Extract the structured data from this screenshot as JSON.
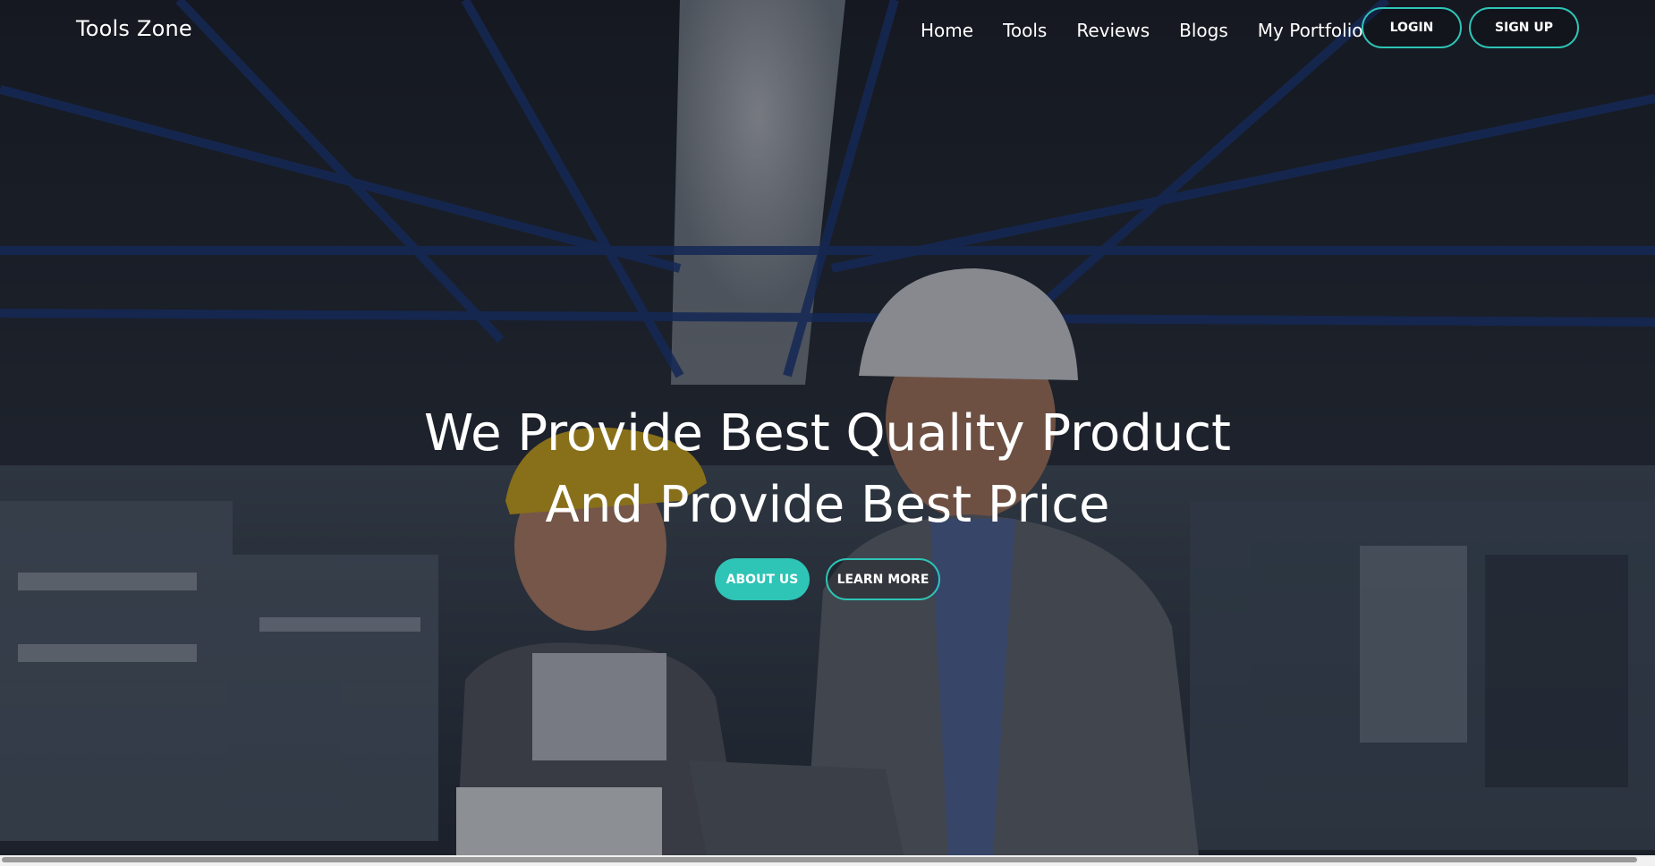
{
  "brand": {
    "name": "Tools Zone"
  },
  "nav": {
    "items": [
      {
        "label": "Home"
      },
      {
        "label": "Tools"
      },
      {
        "label": "Reviews"
      },
      {
        "label": "Blogs"
      },
      {
        "label": "My Portfolio"
      }
    ],
    "login_label": "LOGIN",
    "signup_label": "SIGN UP"
  },
  "hero": {
    "headline_line1": "We Provide Best Quality Product",
    "headline_line2": "And Provide Best Price",
    "about_label": "ABOUT US",
    "learn_label": "LEARN MORE"
  },
  "colors": {
    "accent": "#2ec4b6",
    "text": "#ffffff",
    "overlay": "#080a12"
  }
}
